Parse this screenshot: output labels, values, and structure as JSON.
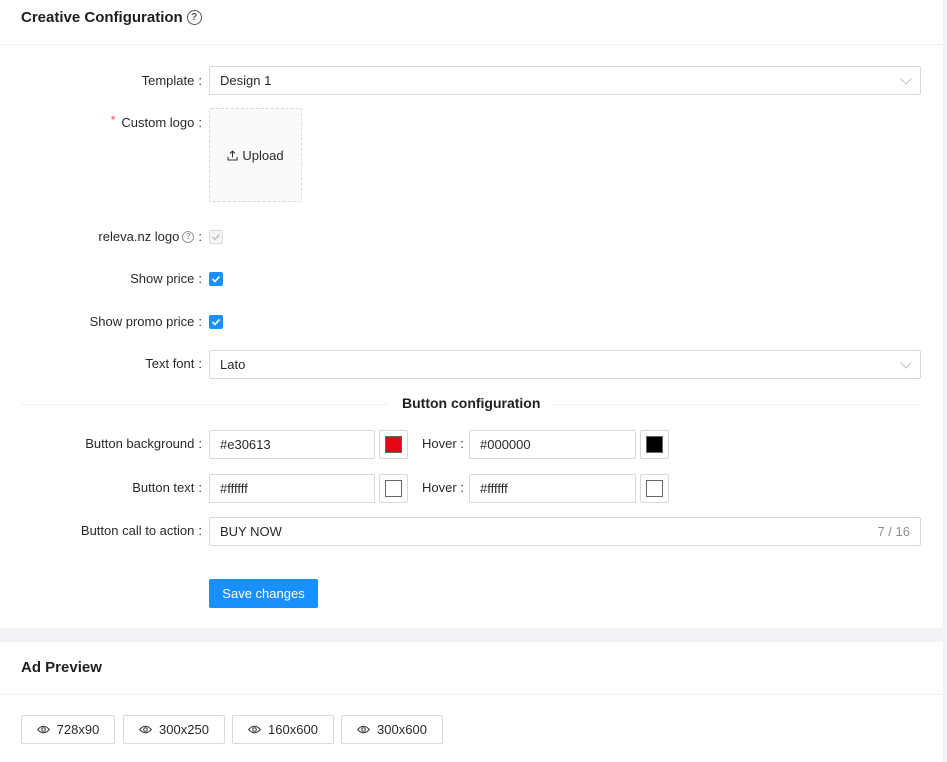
{
  "creative": {
    "title": "Creative Configuration",
    "template": {
      "label": "Template",
      "value": "Design 1"
    },
    "custom_logo": {
      "label": "Custom logo",
      "required_mark": "*",
      "upload_label": "Upload"
    },
    "releva_logo": {
      "label": "releva.nz logo",
      "checked": true,
      "disabled": true
    },
    "show_price": {
      "label": "Show price",
      "checked": true
    },
    "show_promo_price": {
      "label": "Show promo price",
      "checked": true
    },
    "text_font": {
      "label": "Text font",
      "value": "Lato"
    },
    "button_config_title": "Button configuration",
    "button_background": {
      "label": "Button background",
      "value": "#e30613",
      "color": "#e30613",
      "hover_label": "Hover",
      "hover_value": "#000000",
      "hover_color": "#000000"
    },
    "button_text": {
      "label": "Button text",
      "value": "#ffffff",
      "color": "#ffffff",
      "hover_label": "Hover",
      "hover_value": "#ffffff",
      "hover_color": "#ffffff"
    },
    "button_cta": {
      "label": "Button call to action",
      "value": "BUY NOW",
      "count": "7 / 16"
    },
    "save_label": "Save changes"
  },
  "preview": {
    "title": "Ad Preview",
    "sizes": [
      "728x90",
      "300x250",
      "160x600",
      "300x600"
    ]
  },
  "colors": {
    "primary": "#1890ff",
    "required": "#ff4d4f"
  }
}
